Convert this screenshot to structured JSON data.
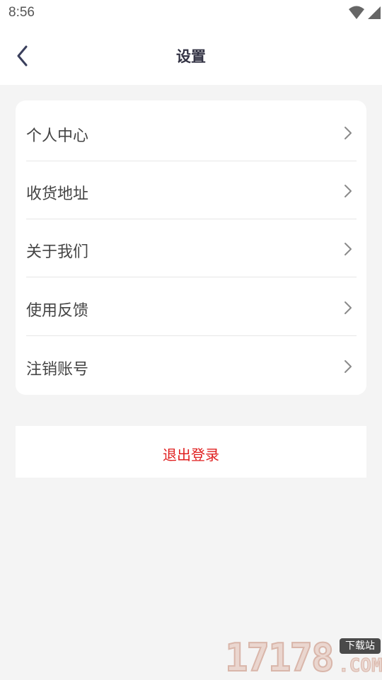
{
  "status_bar": {
    "time": "8:56",
    "icons": [
      "wifi-icon",
      "signal-icon",
      "battery-charging-icon"
    ]
  },
  "nav": {
    "title": "设置",
    "back_icon": "chevron-left-icon"
  },
  "menu": {
    "items": [
      {
        "label": "个人中心"
      },
      {
        "label": "收货地址"
      },
      {
        "label": "关于我们"
      },
      {
        "label": "使用反馈"
      },
      {
        "label": "注销账号"
      }
    ],
    "item_icon": "chevron-right-icon"
  },
  "logout": {
    "label": "退出登录",
    "color": "#e02020"
  },
  "watermark": {
    "digits": "17178",
    "badge": "下载站",
    "suffix": ".COM"
  },
  "colors": {
    "background": "#f4f4f4",
    "card": "#ffffff",
    "text": "#444444",
    "title": "#333344"
  }
}
